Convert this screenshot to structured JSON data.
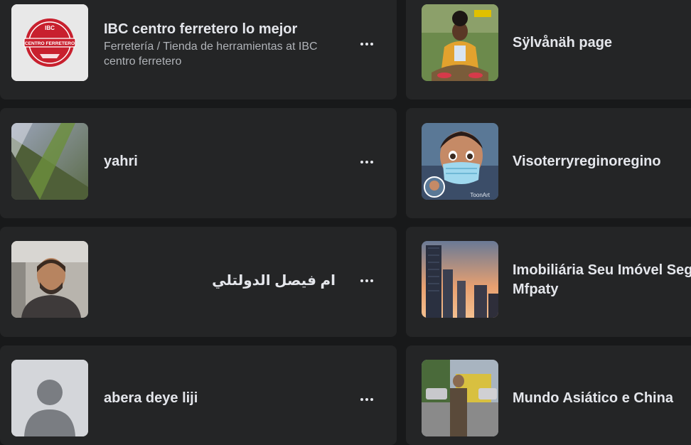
{
  "left_column": [
    {
      "name": "IBC centro ferretero lo mejor",
      "subtitle": "Ferretería / Tienda de herramientas at IBC centro ferretero",
      "logo_text_top": "IBC",
      "logo_text_main": "CENTRO FERRETERO",
      "more_icon": "more-dots-icon"
    },
    {
      "name": "yahri",
      "more_icon": "more-dots-icon"
    },
    {
      "name": "ام فيصل الدولتلي",
      "more_icon": "more-dots-icon"
    },
    {
      "name": "abera deye liji",
      "more_icon": "more-dots-icon"
    }
  ],
  "right_column": [
    {
      "name": "Sÿlvånäh page"
    },
    {
      "name": "Visoterryreginoregino",
      "avatar_badge_text": "ToonArt"
    },
    {
      "name": "Imobiliária Seu Imóvel Seguro",
      "name_line2": "Mfpaty"
    },
    {
      "name": "Mundo Asiático e China"
    }
  ],
  "colors": {
    "background": "#18191a",
    "card": "#242526",
    "primary_text": "#e4e6eb",
    "secondary_text": "#b0b3b8",
    "logo_red": "#c8202e"
  }
}
